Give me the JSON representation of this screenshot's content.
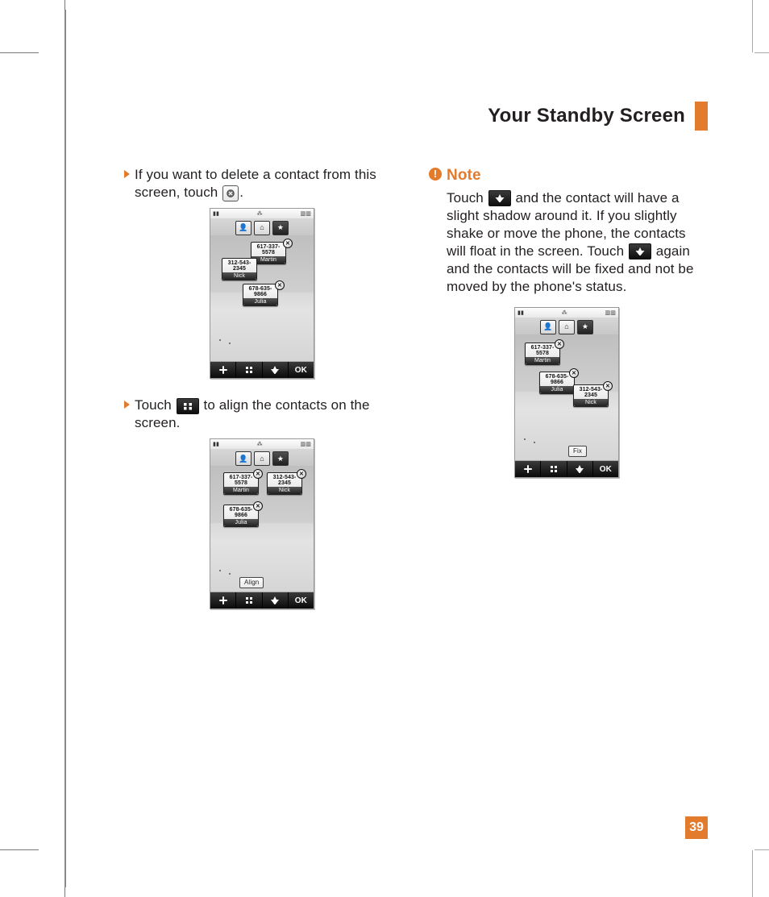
{
  "header": {
    "title": "Your Standby Screen"
  },
  "page_number": "39",
  "left": {
    "b1_pre": "If you want to delete a contact from this screen, touch ",
    "b1_post": ".",
    "b2_pre": "Touch ",
    "b2_post": " to align the contacts on the screen."
  },
  "note": {
    "label": "Note",
    "t1": "Touch ",
    "t2": " and the contact will have a slight shadow around it. If you slightly shake or move the phone, the contacts will float in the screen. Touch ",
    "t3": " again and the contacts will be fixed and not be moved by the phone's status."
  },
  "icons": {
    "delete": "delete-contact-icon",
    "align": "align-grid-icon",
    "pin": "pin-icon"
  },
  "ui": {
    "ok": "OK",
    "align_tip": "Align",
    "fix_tip": "Fix"
  },
  "contacts": {
    "martin": {
      "num": "617-337-5578",
      "name": "Martin"
    },
    "nick": {
      "num": "312-543-2345",
      "name": "Nick"
    },
    "julia": {
      "num": "678-635-9866",
      "name": "Julia"
    }
  }
}
